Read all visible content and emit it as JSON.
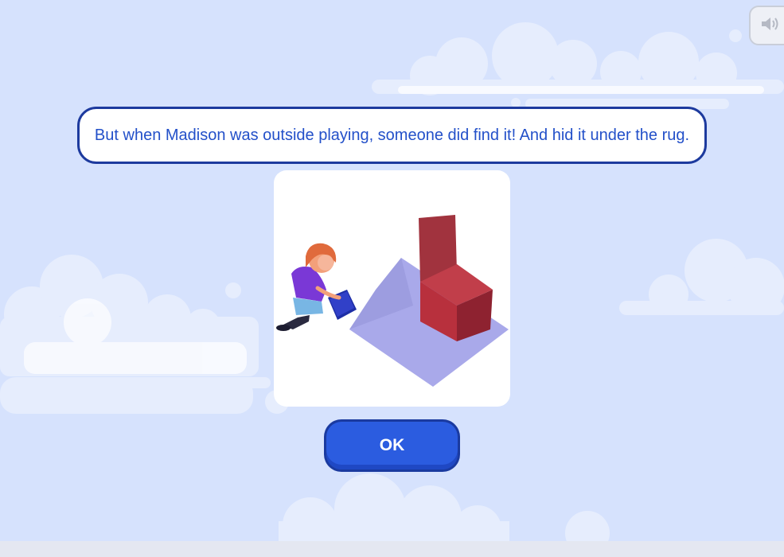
{
  "narration": {
    "text": "But when Madison was outside playing, someone did find it! And hid it under the rug."
  },
  "illustration": {
    "icon": "girl-lifting-rug-with-box-illustration"
  },
  "buttons": {
    "ok_label": "OK"
  },
  "sound": {
    "icon": "speaker-icon"
  },
  "colors": {
    "background": "#d6e2fd",
    "accent": "#2b5ce0",
    "text": "#2350c9",
    "border": "#1d3a9e"
  }
}
